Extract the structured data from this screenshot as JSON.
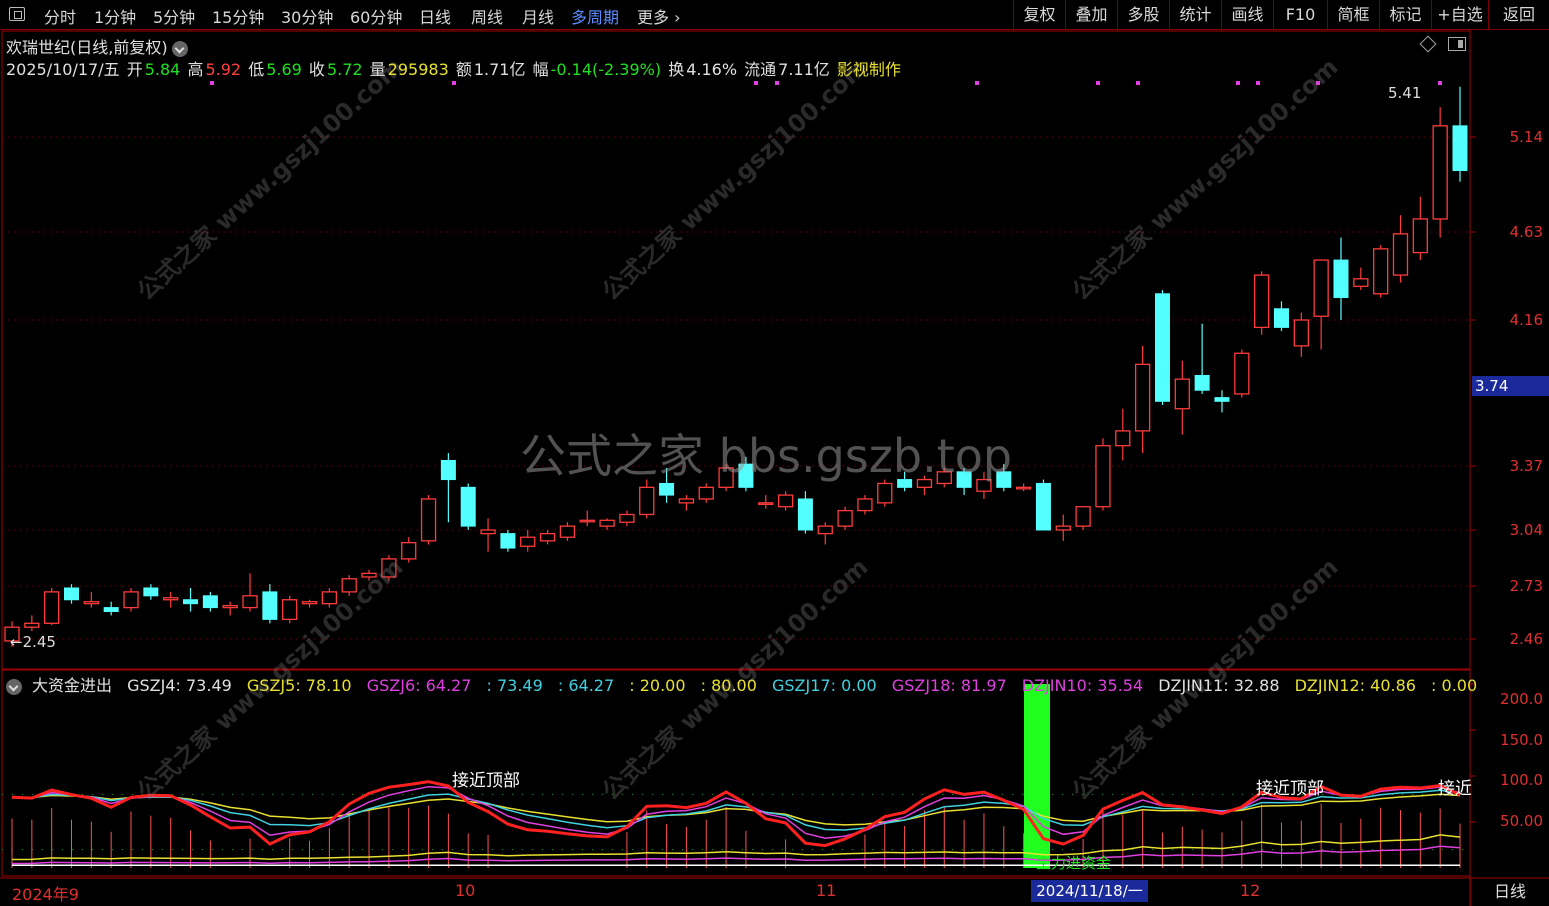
{
  "toolbar": {
    "periods": [
      "分时",
      "1分钟",
      "5分钟",
      "15分钟",
      "30分钟",
      "60分钟",
      "日线",
      "周线",
      "月线",
      "多周期",
      "更多"
    ],
    "active_period": "多周期",
    "right_buttons": [
      "复权",
      "叠加",
      "多股",
      "统计",
      "画线",
      "F10",
      "简框",
      "标记",
      "+自选",
      "返回"
    ]
  },
  "stock": {
    "title": "欢瑞世纪(日线,前复权)",
    "date": "2025/10/17/五",
    "open_label": "开",
    "open": "5.84",
    "high_label": "高",
    "high": "5.92",
    "low_label": "低",
    "low": "5.69",
    "close_label": "收",
    "close": "5.72",
    "vol_label": "量",
    "vol": "295983",
    "amount_label": "额",
    "amount": "1.71亿",
    "change_label": "幅",
    "change": "-0.14(-2.39%)",
    "turnover_label": "换",
    "turnover": "4.16%",
    "float_label": "流通",
    "float": "7.11亿",
    "maker": "影视制作"
  },
  "price_axis": [
    "5.14",
    "4.63",
    "4.16",
    "3.37",
    "3.04",
    "2.73",
    "2.46"
  ],
  "current_price": "3.74",
  "max_marker": "5.41",
  "min_marker": "2.45",
  "indicator": {
    "name": "大资金进出",
    "legend": [
      {
        "text": "GSZJ4: 73.49",
        "color": "#e0e0e0"
      },
      {
        "text": "GSZJ5: 78.10",
        "color": "#e8e030"
      },
      {
        "text": "GSZJ6: 64.27",
        "color": "#e040e0"
      },
      {
        "text": ": 73.49",
        "color": "#40d0e0"
      },
      {
        "text": ": 64.27",
        "color": "#40d0e0"
      },
      {
        "text": ": 20.00",
        "color": "#e8e030"
      },
      {
        "text": ": 80.00",
        "color": "#e8e030"
      },
      {
        "text": "GSZJ17: 0.00",
        "color": "#40d0e0"
      },
      {
        "text": "GSZJ18: 81.97",
        "color": "#e040e0"
      },
      {
        "text": "DZJIN10: 35.54",
        "color": "#e040e0"
      },
      {
        "text": "DZJIN11: 32.88",
        "color": "#e0e0e0"
      },
      {
        "text": "DZJIN12: 40.86",
        "color": "#e8e030"
      },
      {
        "text": ": 0.00",
        "color": "#e8e030"
      }
    ],
    "axis": [
      "200.0",
      "150.0",
      "100.0",
      "50.00"
    ],
    "labels": [
      "接近顶部",
      "接近顶部",
      "接近"
    ],
    "main_label": "主力进资金"
  },
  "dates": [
    "2024年9",
    "10",
    "11",
    "12"
  ],
  "cursor_date": "2024/11/18/一",
  "period_button": "日线",
  "watermark": "公式之家 bbs.gszb.top",
  "watermark_small": "公式之家 www.gszj100.com",
  "candles": [
    [
      2.45,
      2.55,
      2.42,
      2.52
    ],
    [
      2.52,
      2.58,
      2.5,
      2.54
    ],
    [
      2.54,
      2.72,
      2.53,
      2.7
    ],
    [
      2.72,
      2.74,
      2.64,
      2.66
    ],
    [
      2.64,
      2.7,
      2.62,
      2.65
    ],
    [
      2.62,
      2.65,
      2.58,
      2.6
    ],
    [
      2.62,
      2.72,
      2.6,
      2.7
    ],
    [
      2.72,
      2.74,
      2.66,
      2.68
    ],
    [
      2.66,
      2.7,
      2.62,
      2.67
    ],
    [
      2.66,
      2.72,
      2.6,
      2.64
    ],
    [
      2.68,
      2.7,
      2.6,
      2.62
    ],
    [
      2.62,
      2.65,
      2.58,
      2.63
    ],
    [
      2.62,
      2.8,
      2.6,
      2.68
    ],
    [
      2.7,
      2.74,
      2.54,
      2.56
    ],
    [
      2.56,
      2.68,
      2.54,
      2.66
    ],
    [
      2.64,
      2.66,
      2.62,
      2.65
    ],
    [
      2.64,
      2.72,
      2.62,
      2.7
    ],
    [
      2.7,
      2.79,
      2.68,
      2.77
    ],
    [
      2.78,
      2.82,
      2.76,
      2.8
    ],
    [
      2.78,
      2.9,
      2.76,
      2.88
    ],
    [
      2.88,
      3.0,
      2.86,
      2.97
    ],
    [
      2.98,
      3.22,
      2.96,
      3.2
    ],
    [
      3.4,
      3.44,
      3.08,
      3.3
    ],
    [
      3.26,
      3.28,
      3.04,
      3.06
    ],
    [
      3.02,
      3.1,
      2.92,
      3.04
    ],
    [
      3.02,
      3.04,
      2.92,
      2.94
    ],
    [
      2.95,
      3.04,
      2.92,
      3.0
    ],
    [
      2.98,
      3.04,
      2.96,
      3.02
    ],
    [
      3.0,
      3.08,
      2.98,
      3.06
    ],
    [
      3.09,
      3.14,
      3.06,
      3.09
    ],
    [
      3.06,
      3.1,
      3.04,
      3.09
    ],
    [
      3.08,
      3.14,
      3.06,
      3.12
    ],
    [
      3.12,
      3.3,
      3.1,
      3.26
    ],
    [
      3.28,
      3.36,
      3.18,
      3.22
    ],
    [
      3.18,
      3.22,
      3.14,
      3.2
    ],
    [
      3.2,
      3.28,
      3.18,
      3.26
    ],
    [
      3.26,
      3.38,
      3.24,
      3.36
    ],
    [
      3.38,
      3.42,
      3.24,
      3.26
    ],
    [
      3.18,
      3.22,
      3.15,
      3.18
    ],
    [
      3.16,
      3.24,
      3.14,
      3.22
    ],
    [
      3.2,
      3.24,
      3.02,
      3.04
    ],
    [
      3.02,
      3.08,
      2.96,
      3.06
    ],
    [
      3.06,
      3.16,
      3.04,
      3.14
    ],
    [
      3.14,
      3.22,
      3.12,
      3.2
    ],
    [
      3.18,
      3.3,
      3.16,
      3.28
    ],
    [
      3.3,
      3.34,
      3.24,
      3.26
    ],
    [
      3.26,
      3.32,
      3.22,
      3.3
    ],
    [
      3.28,
      3.36,
      3.26,
      3.34
    ],
    [
      3.34,
      3.36,
      3.22,
      3.26
    ],
    [
      3.24,
      3.34,
      3.2,
      3.3
    ],
    [
      3.34,
      3.38,
      3.24,
      3.26
    ],
    [
      3.26,
      3.28,
      3.24,
      3.26
    ],
    [
      3.28,
      3.3,
      3.04,
      3.04
    ],
    [
      3.04,
      3.12,
      2.98,
      3.06
    ],
    [
      3.06,
      3.16,
      3.04,
      3.16
    ],
    [
      3.16,
      3.52,
      3.14,
      3.48
    ],
    [
      3.48,
      3.68,
      3.4,
      3.56
    ],
    [
      3.56,
      4.02,
      3.44,
      3.92
    ],
    [
      4.3,
      4.32,
      3.7,
      3.72
    ],
    [
      3.68,
      3.94,
      3.54,
      3.84
    ],
    [
      3.86,
      4.14,
      3.76,
      3.78
    ],
    [
      3.74,
      3.78,
      3.66,
      3.72
    ],
    [
      3.76,
      4.0,
      3.74,
      3.98
    ],
    [
      4.12,
      4.42,
      4.08,
      4.4
    ],
    [
      4.22,
      4.26,
      4.1,
      4.12
    ],
    [
      4.02,
      4.2,
      3.96,
      4.16
    ],
    [
      4.18,
      4.46,
      4.0,
      4.48
    ],
    [
      4.48,
      4.6,
      4.16,
      4.28
    ],
    [
      4.34,
      4.44,
      4.32,
      4.38
    ],
    [
      4.3,
      4.56,
      4.28,
      4.54
    ],
    [
      4.4,
      4.72,
      4.36,
      4.62
    ],
    [
      4.52,
      4.82,
      4.48,
      4.7
    ],
    [
      4.7,
      5.3,
      4.6,
      5.2
    ],
    [
      5.2,
      5.41,
      4.9,
      4.96
    ]
  ]
}
